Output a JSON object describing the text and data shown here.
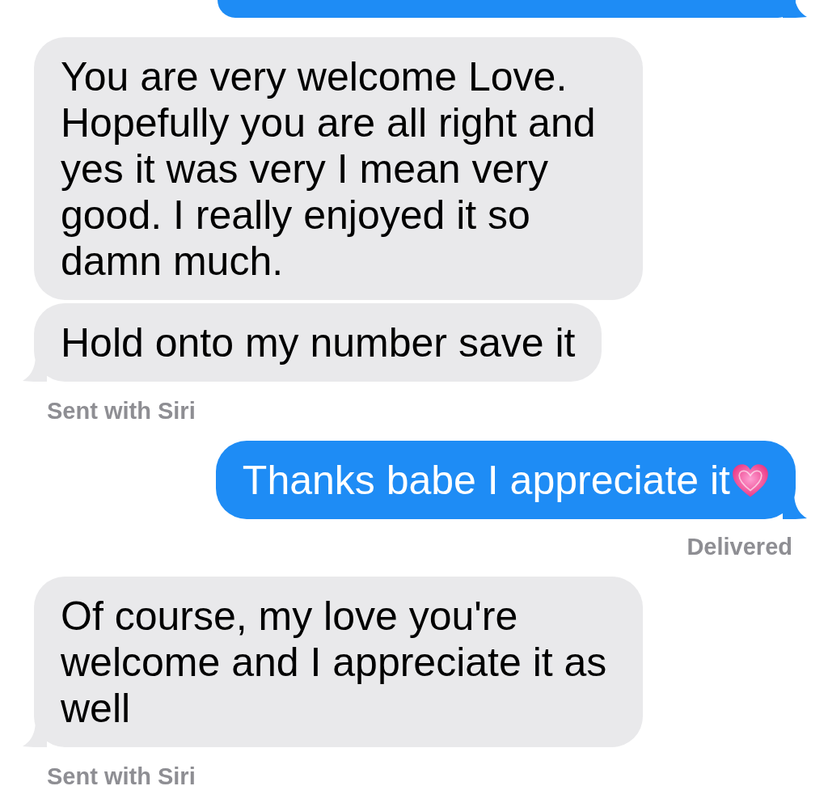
{
  "messages": [
    {
      "kind": "partial_sent",
      "tail": true
    },
    {
      "kind": "received",
      "text": "You are very welcome Love. Hopefully you are all right and yes it was very I mean very good. I really enjoyed it so damn much.",
      "tail": false
    },
    {
      "kind": "received",
      "text": "Hold onto my number save it",
      "tail": true
    },
    {
      "kind": "note",
      "text": "Sent with Siri"
    },
    {
      "kind": "sent",
      "text": "Thanks babe I appreciate it",
      "heart": true,
      "tail": true
    },
    {
      "kind": "note",
      "text": "Delivered"
    },
    {
      "kind": "received",
      "text": "Of course, my love you're welcome and I appreciate it as well",
      "tail": true
    },
    {
      "kind": "note",
      "text": "Sent with Siri"
    }
  ]
}
